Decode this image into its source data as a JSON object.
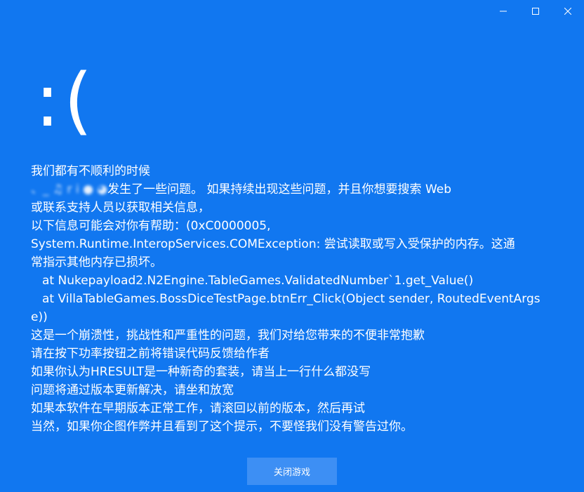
{
  "window": {
    "title": "",
    "minimize_icon": "minimize-icon",
    "maximize_icon": "maximize-icon",
    "close_icon": "close-icon"
  },
  "colors": {
    "background": "#1177f0",
    "button_background": "#3d8ff4",
    "text": "#ffffff"
  },
  "face": ":(",
  "message": {
    "heading": "我们都有不顺利的时候",
    "line2_blurred": "、_ ♫ r i ● ◕",
    "line2_rest": "发生了一些问题。 如果持续出现这些问题，并且你想要搜索 Web",
    "line3": "或联系支持人员以获取相关信息，",
    "line4": "以下信息可能会对你有帮助：(0xC0000005,",
    "line5": "System.Runtime.InteropServices.COMException: 尝试读取或写入受保护的内存。这通",
    "line6": "常指示其他内存已损坏。",
    "line7": "at Nukepayload2.N2Engine.TableGames.ValidatedNumber`1.get_Value()",
    "line8": "at VillaTableGames.BossDiceTestPage.btnErr_Click(Object sender, RoutedEventArgs",
    "line9": "e))",
    "line10": "这是一个崩溃性，挑战性和严重性的问题，我们对给您带来的不便非常抱歉",
    "line11": "请在按下功率按钮之前将错误代码反馈给作者",
    "line12": "如果你认为HRESULT是一种新奇的套装，请当上一行什么都没写",
    "line13": "问题将通过版本更新解决，请坐和放宽",
    "line14": "如果本软件在早期版本正常工作，请滚回以前的版本，然后再试",
    "line15": "当然，如果你企图作弊并且看到了这个提示，不要怪我们没有警告过你。"
  },
  "close_game_button": {
    "label": "关闭游戏"
  }
}
